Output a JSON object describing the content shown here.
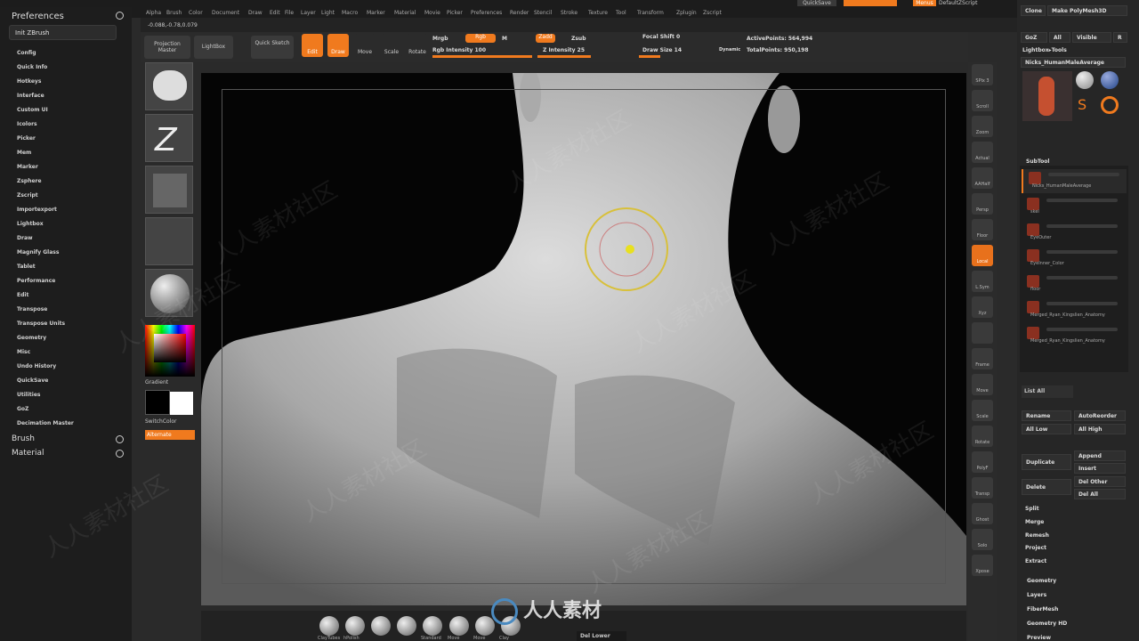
{
  "menubar": {
    "items": [
      "Alpha",
      "Brush",
      "Color",
      "Document",
      "Draw",
      "Edit",
      "File",
      "Layer",
      "Light",
      "Macro",
      "Marker",
      "Material",
      "Movie",
      "Picker",
      "Preferences",
      "Render",
      "Stencil",
      "Stroke",
      "Texture",
      "Tool",
      "Transform",
      "Zplugin",
      "Zscript"
    ],
    "quicksave": "QuickSave",
    "menus": "Menus",
    "script": "DefaultZScript"
  },
  "topinfo": {
    "coords": "-0.088,-0.78,0.079"
  },
  "left": {
    "title": "Preferences",
    "init": "Init ZBrush",
    "items": [
      "Config",
      "Quick Info",
      "Hotkeys",
      "Interface",
      "Custom UI",
      "Icolors",
      "Picker",
      "Mem",
      "Marker",
      "Zsphere",
      "Zscript",
      "Importexport",
      "Lightbox",
      "Draw",
      "Magnify Glass",
      "Tablet",
      "Performance",
      "Edit",
      "Transpose",
      "Transpose Units",
      "Geometry",
      "Misc",
      "Undo History",
      "QuickSave",
      "Utilities",
      "GoZ",
      "Decimation Master"
    ],
    "sections": [
      "Brush",
      "Material"
    ]
  },
  "shelf": {
    "projection": "Projection Master",
    "lightbox": "LightBox",
    "quicksketch": "Quick Sketch",
    "edit": "Edit",
    "draw": "Draw",
    "move": "Move",
    "scale": "Scale",
    "rotate": "Rotate",
    "mrgb": "Mrgb",
    "rgb": "Rgb",
    "m": "M",
    "rgb_intensity": "Rgb Intensity 100",
    "zadd": "Zadd",
    "zsub": "Zsub",
    "z_intensity": "Z Intensity 25",
    "focal_shift": "Focal Shift 0",
    "draw_size": "Draw Size 14",
    "dynamic": "Dynamic",
    "active_points": "ActivePoints: 564,994",
    "total_points": "TotalPoints: 950,198"
  },
  "lshelf": {
    "gradient": "Gradient",
    "switchcolor": "SwitchColor",
    "alternate": "Alternate"
  },
  "rshelf": {
    "icons": [
      "SPix 3",
      "Scroll",
      "Zoom",
      "Actual",
      "AAHalf",
      "Persp",
      "Floor",
      "Local",
      "L.Sym",
      "Xyz",
      "",
      "Frame",
      "Move",
      "Scale",
      "Rotate",
      "PolyF",
      "Transp",
      "Ghost",
      "Solo",
      "Xpose"
    ]
  },
  "rpanel": {
    "clone": "Clone",
    "make_polymesh": "Make PolyMesh3D",
    "goz": "GoZ",
    "all": "All",
    "visible": "Visible",
    "r": "R",
    "lightbox_tools": "Lightbox▸Tools",
    "tool_name": "Nicks_HumanMaleAverage",
    "subtool": "SubTool",
    "subtools": [
      "Nicks_HumanMaleAverage",
      "skel",
      "EyeOuter",
      "EyeInner_Color",
      "floor",
      "Merged_Ryan_Kingslien_Anatomy",
      "Merged_Ryan_Kingslien_Anatomy"
    ],
    "list_all": "List All",
    "rename": "Rename",
    "autoreorder": "AutoReorder",
    "all_low": "All Low",
    "all_high": "All High",
    "duplicate": "Duplicate",
    "append": "Append",
    "insert": "Insert",
    "delete": "Delete",
    "del_other": "Del Other",
    "del_all": "Del All",
    "split": "Split",
    "merge": "Merge",
    "remesh": "Remesh",
    "project": "Project",
    "extract": "Extract",
    "geometry": "Geometry",
    "layers": "Layers",
    "fibermesh": "FiberMesh",
    "geometry_hd": "Geometry HD",
    "preview": "Preview"
  },
  "bottom": {
    "brushes": [
      "ClayTubes",
      "hPolish",
      "",
      "",
      "Standard",
      "Move",
      "Move",
      "Clay"
    ],
    "del_lower": "Del Lower"
  },
  "watermark": {
    "text": "人人素材社区",
    "logo": "人人素材"
  }
}
